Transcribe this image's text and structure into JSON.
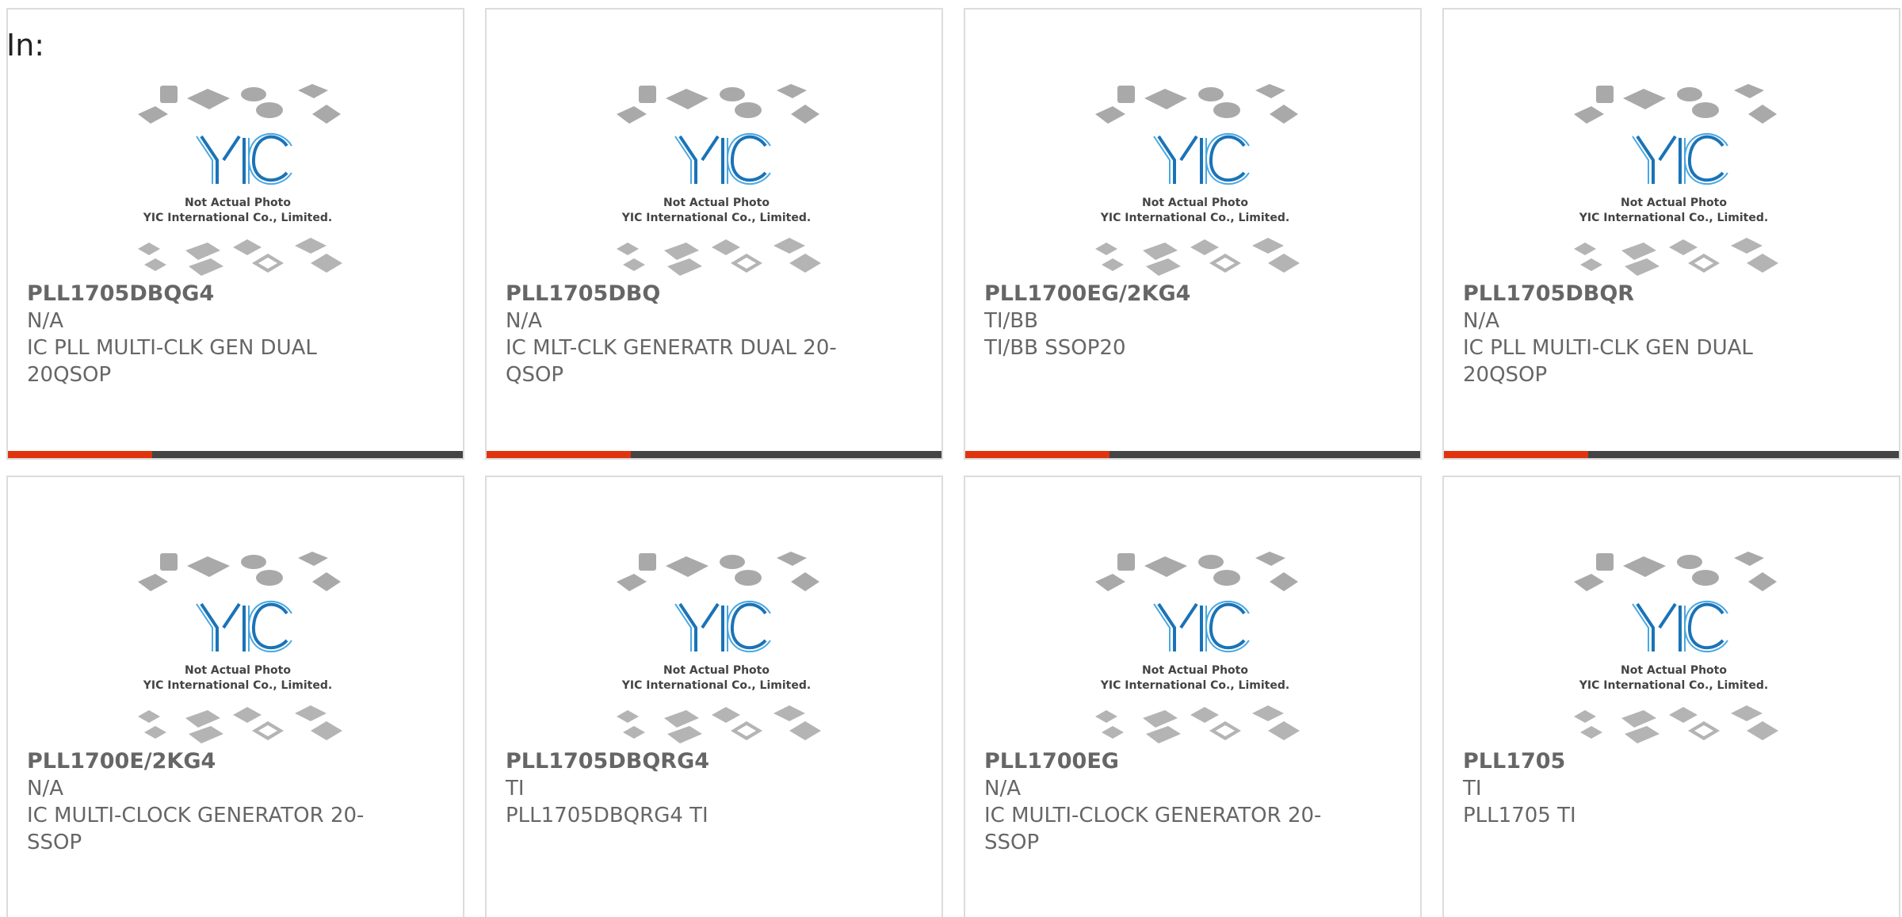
{
  "header": {
    "in_label": "In:"
  },
  "photo": {
    "line1": "Not Actual Photo",
    "line2": "YIC International Co., Limited.",
    "logo_text": "YIC"
  },
  "accent_color": "#e0340f",
  "bar_color": "#444444",
  "cards": [
    {
      "part": "PLL1705DBQG4",
      "mfr": "N/A",
      "desc": "IC PLL MULTI-CLK GEN DUAL 20QSOP"
    },
    {
      "part": "PLL1705DBQ",
      "mfr": "N/A",
      "desc": "IC MLT-CLK GENERATR DUAL 20-QSOP"
    },
    {
      "part": "PLL1700EG/2KG4",
      "mfr": "TI/BB",
      "desc": "TI/BB SSOP20"
    },
    {
      "part": "PLL1705DBQR",
      "mfr": "N/A",
      "desc": "IC PLL MULTI-CLK GEN DUAL 20QSOP"
    },
    {
      "part": "PLL1700E/2KG4",
      "mfr": "N/A",
      "desc": "IC MULTI-CLOCK GENERATOR 20-SSOP"
    },
    {
      "part": "PLL1705DBQRG4",
      "mfr": "TI",
      "desc": "PLL1705DBQRG4 TI"
    },
    {
      "part": "PLL1700EG",
      "mfr": "N/A",
      "desc": "IC MULTI-CLOCK GENERATOR 20-SSOP"
    },
    {
      "part": "PLL1705",
      "mfr": "TI",
      "desc": "PLL1705 TI"
    }
  ]
}
